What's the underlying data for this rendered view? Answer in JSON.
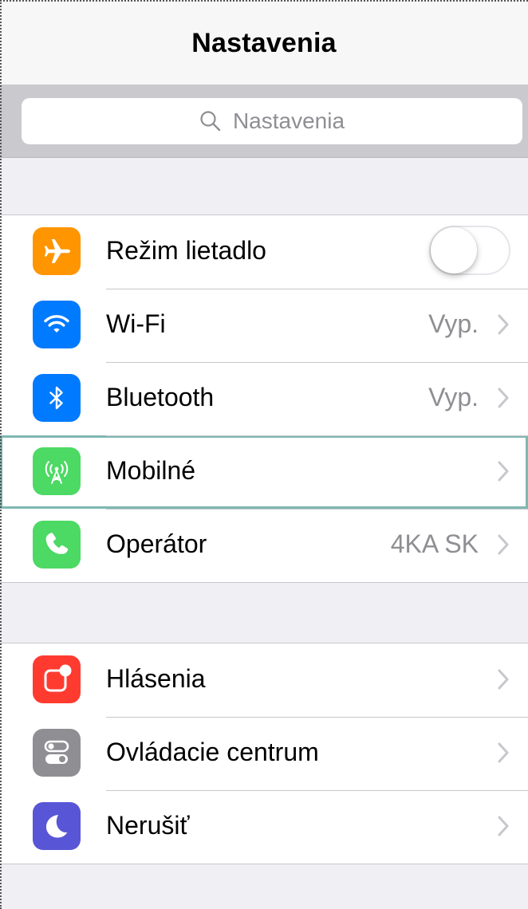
{
  "nav": {
    "title": "Nastavenia"
  },
  "search": {
    "placeholder": "Nastavenia"
  },
  "groups": [
    {
      "items": [
        {
          "label": "Režim lietadlo",
          "icon": "airplane-icon",
          "color": "#ff9500",
          "toggle_on": false
        },
        {
          "label": "Wi-Fi",
          "value": "Vyp.",
          "icon": "wifi-icon",
          "color": "#007aff"
        },
        {
          "label": "Bluetooth",
          "value": "Vyp.",
          "icon": "bluetooth-icon",
          "color": "#007aff"
        },
        {
          "label": "Mobilné",
          "icon": "cellular-antenna-icon",
          "color": "#4cd964"
        },
        {
          "label": "Operátor",
          "value": "4KA SK",
          "icon": "phone-icon",
          "color": "#4cd964"
        }
      ]
    },
    {
      "items": [
        {
          "label": "Hlásenia",
          "icon": "notifications-icon",
          "color": "#ff3b30"
        },
        {
          "label": "Ovládacie centrum",
          "icon": "control-center-icon",
          "color": "#8e8e93"
        },
        {
          "label": "Nerušiť",
          "icon": "moon-icon",
          "color": "#5856d6"
        }
      ]
    }
  ]
}
